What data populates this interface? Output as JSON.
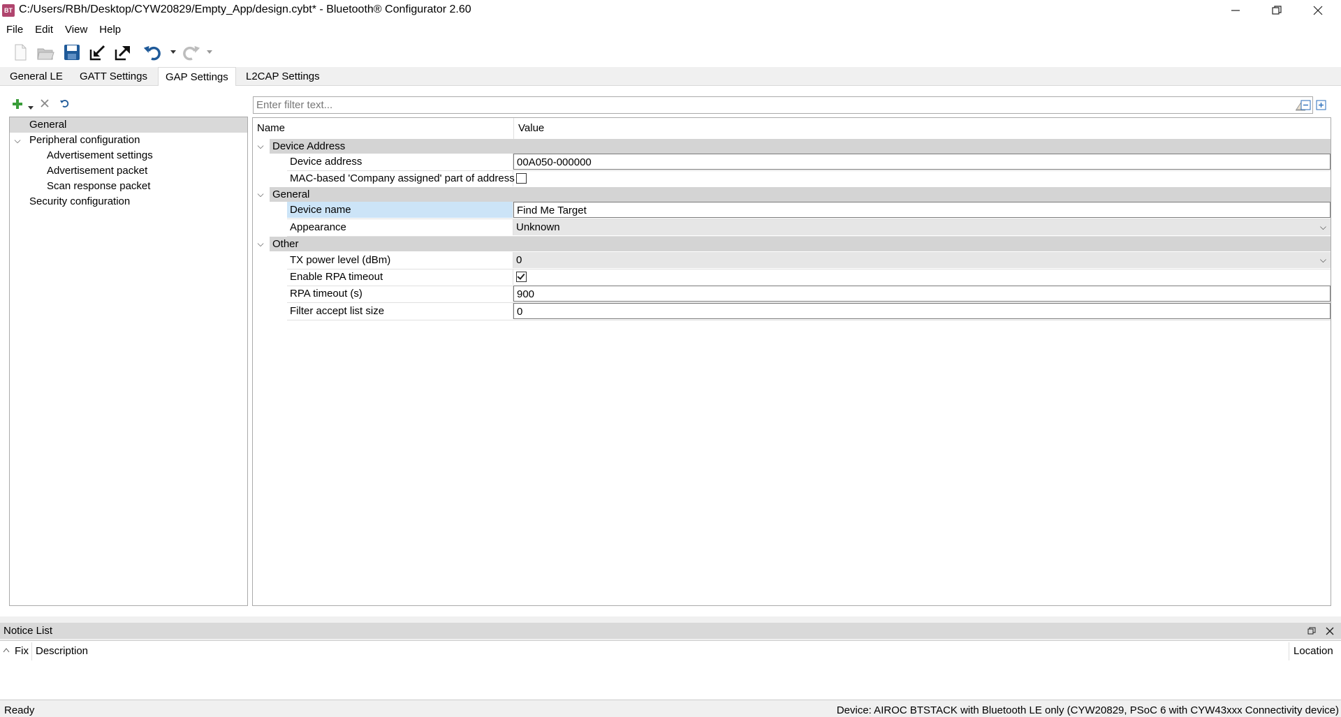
{
  "window": {
    "title": "C:/Users/RBh/Desktop/CYW20829/Empty_App/design.cybt* - Bluetooth® Configurator 2.60",
    "app_icon_text": "BT"
  },
  "menu": [
    "File",
    "Edit",
    "View",
    "Help"
  ],
  "tabs": [
    {
      "label": "General LE",
      "active": false
    },
    {
      "label": "GATT Settings",
      "active": false
    },
    {
      "label": "GAP Settings",
      "active": true
    },
    {
      "label": "L2CAP Settings",
      "active": false
    }
  ],
  "tree": {
    "items": [
      {
        "label": "General",
        "level": 0,
        "selected": true
      },
      {
        "label": "Peripheral configuration",
        "level": 0,
        "expanded": true
      },
      {
        "label": "Advertisement settings",
        "level": 1
      },
      {
        "label": "Advertisement packet",
        "level": 1
      },
      {
        "label": "Scan response packet",
        "level": 1
      },
      {
        "label": "Security configuration",
        "level": 0
      }
    ]
  },
  "filter": {
    "placeholder": "Enter filter text..."
  },
  "grid": {
    "headers": {
      "name": "Name",
      "value": "Value"
    },
    "categories": [
      {
        "label": "Device Address",
        "rows": [
          {
            "name": "Device address",
            "value": "00A050-000000",
            "type": "text"
          },
          {
            "name": "MAC-based 'Company assigned' part of address",
            "value": "",
            "type": "checkbox",
            "checked": false
          }
        ]
      },
      {
        "label": "General",
        "rows": [
          {
            "name": "Device name",
            "value": "Find Me Target",
            "type": "text",
            "selected": true
          },
          {
            "name": "Appearance",
            "value": "Unknown",
            "type": "combo"
          }
        ]
      },
      {
        "label": "Other",
        "rows": [
          {
            "name": "TX power level (dBm)",
            "value": "0",
            "type": "combo"
          },
          {
            "name": "Enable RPA timeout",
            "value": "",
            "type": "checkbox",
            "checked": true
          },
          {
            "name": "RPA timeout (s)",
            "value": "900",
            "type": "text"
          },
          {
            "name": "Filter accept list size",
            "value": "0",
            "type": "text"
          }
        ]
      }
    ]
  },
  "notice_list": {
    "title": "Notice List",
    "columns": {
      "fix": "Fix",
      "description": "Description",
      "location": "Location"
    }
  },
  "status": {
    "left": "Ready",
    "right": "Device: AIROC BTSTACK with Bluetooth LE only (CYW20829, PSoC 6 with CYW43xxx Connectivity device)"
  },
  "colors": {
    "selection": "#cce4f7",
    "category_bar": "#d4d4d4",
    "tree_selection": "#d9d9d9"
  }
}
